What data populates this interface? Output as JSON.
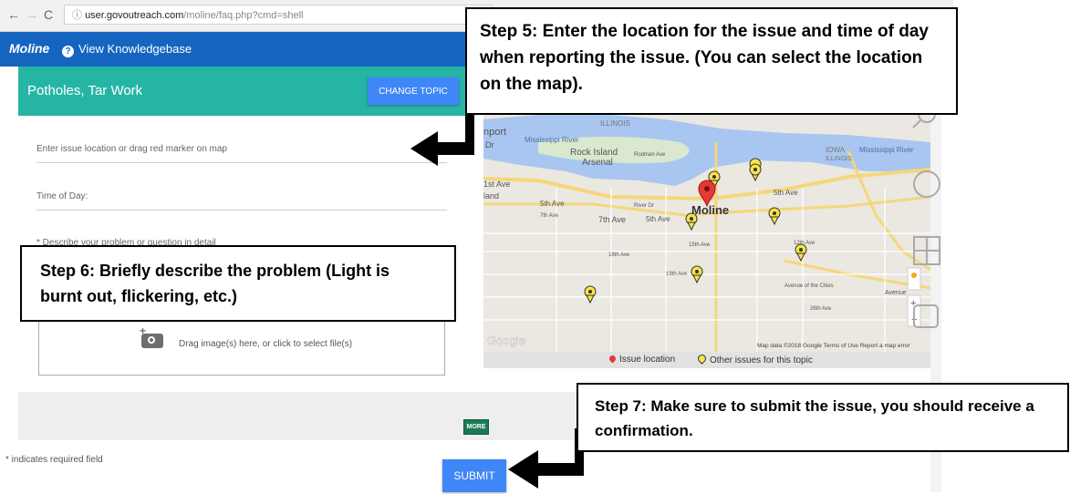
{
  "browser": {
    "url_host": "user.govoutreach.com",
    "url_path": "/moline/faq.php?cmd=shell"
  },
  "header": {
    "brand": "Moline",
    "kb_link": "View Knowledgebase"
  },
  "topic": {
    "title": "Potholes, Tar Work",
    "change_label": "CHANGE TOPIC"
  },
  "form": {
    "location_placeholder": "Enter issue location or drag red marker on map",
    "time_label": "Time of Day:",
    "describe_label": "* Describe your problem or question in detail",
    "upload_text": "Drag image(s) here, or click to select file(s)",
    "more_label": "MORE",
    "required_note": "* indicates required field",
    "submit_label": "SUBMIT"
  },
  "map": {
    "labels": {
      "port": "nport",
      "dr": "Dr",
      "river": "Mississippi River",
      "illinois_top": "ILLINOIS",
      "rock_island": "Rock Island",
      "arsenal": "Arsenal",
      "rodman": "Rodman Ave",
      "iowa": "IOWA",
      "illinois_right": "ILLINOIS",
      "river_right": "Mississippi River",
      "first_ave": "1st Ave",
      "land": "land",
      "fifth_ave_left": "5th Ave",
      "seventh_ave_left": "7th Ave",
      "river_dr": "River Dr",
      "seventh_ave": "7th Ave",
      "fifth_ave_mid": "5th Ave",
      "moline": "Moline",
      "fifth_ave_right": "5th Ave",
      "twelfth_ave": "12th Ave",
      "eighteenth_ave": "18th Ave",
      "fifteenth_ave": "15th Ave",
      "nineteenth_ave": "19th Ave",
      "avenue_cities": "Avenue of the Cities",
      "avenue_right": "Avenue",
      "twentysixth": "26th Ave",
      "google": "Google",
      "attribution": "Map data ©2018 Google   Terms of Use   Report a map error"
    },
    "legend_issue": "Issue location",
    "legend_other": "Other issues for this topic"
  },
  "callouts": {
    "step5": "Step 5: Enter the location for the issue and time of day when reporting the issue. (You can select the location on the map).",
    "step6": "Step 6: Briefly describe the problem (Light is burnt out, flickering, etc.)",
    "step7": "Step 7: Make sure to submit the issue, you should receive a confirmation."
  },
  "colors": {
    "header_blue": "#1565c0",
    "topic_teal": "#26b5a5",
    "button_blue": "#3f86f7",
    "more_green": "#1b7a55",
    "issue_pin_red": "#e53935",
    "other_pin_yellow": "#f6e544"
  }
}
